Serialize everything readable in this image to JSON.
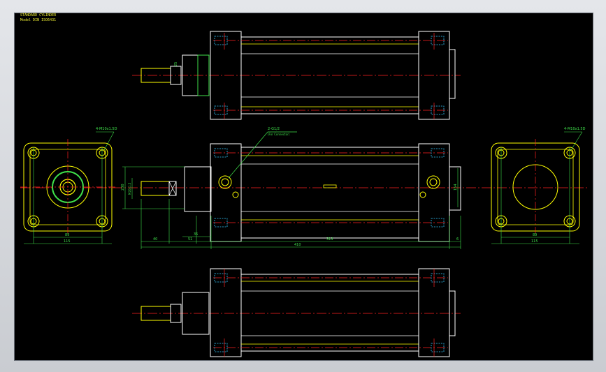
{
  "header": {
    "title": "STANDARD CYLINDER",
    "subtitle": "Model DIN ISO6431"
  },
  "annotations": {
    "left_end_thread": "4-M10x1.5D",
    "right_end_thread": "4-M10x1.5D",
    "port_note": "2-G1/2",
    "port_note_sub": "(For Connector)"
  },
  "dimensions": {
    "rod_dia": "25",
    "rod_thread": "M20x1.5",
    "bore_height": "230",
    "rod_length": "40",
    "nose_length": "51",
    "boss_length": "35",
    "total_length": "410",
    "body_length": "313",
    "cap_offset": "6",
    "right_height": "154",
    "left_pitch": "89",
    "left_width": "115",
    "right_pitch": "89",
    "right_width": "115"
  },
  "colors": {
    "background": "#000000",
    "outline": "#ffffff",
    "body": "#ffff00",
    "center": "#ff2020",
    "dimension": "#33e04a",
    "hidden": "#33c8ff"
  }
}
